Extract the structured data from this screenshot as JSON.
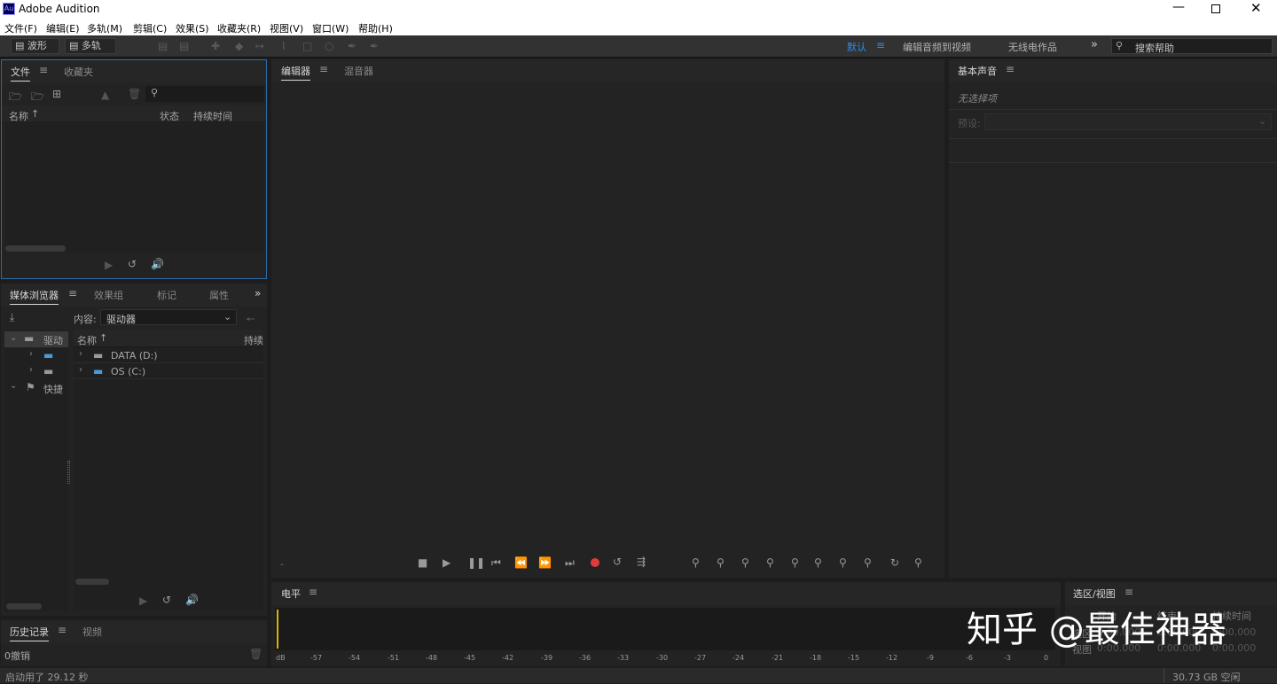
{
  "window": {
    "title": "Adobe Audition",
    "logo": "Au"
  },
  "menu": [
    "文件(F)",
    "编辑(E)",
    "多轨(M)",
    "剪辑(C)",
    "效果(S)",
    "收藏夹(R)",
    "视图(V)",
    "窗口(W)",
    "帮助(H)"
  ],
  "toolbar": {
    "waveform": "波形",
    "multitrack": "多轨",
    "workspaces": [
      "默认",
      "编辑音频到视频",
      "无线电作品"
    ],
    "search_placeholder": "搜索帮助"
  },
  "files_panel": {
    "tabs": [
      "文件",
      "收藏夹"
    ],
    "columns": [
      "名称",
      "状态",
      "持续时间"
    ]
  },
  "media_browser": {
    "tabs": [
      "媒体浏览器",
      "效果组",
      "标记",
      "属性"
    ],
    "content_label": "内容:",
    "content_value": "驱动器",
    "tree": [
      "驱动",
      "快捷"
    ],
    "list_header_name": "名称",
    "list_header_dur": "持续",
    "items": [
      "DATA (D:)",
      "OS (C:)"
    ]
  },
  "history": {
    "tabs": [
      "历史记录",
      "视频"
    ],
    "undo": "0撤销"
  },
  "editor": {
    "tabs": [
      "编辑器",
      "混音器"
    ],
    "dash": "-"
  },
  "levels": {
    "title": "电平",
    "scale": [
      "dB",
      "-57",
      "-54",
      "-51",
      "-48",
      "-45",
      "-42",
      "-39",
      "-36",
      "-33",
      "-30",
      "-27",
      "-24",
      "-21",
      "-18",
      "-15",
      "-12",
      "-9",
      "-6",
      "-3",
      "0"
    ]
  },
  "essential_sound": {
    "title": "基本声音",
    "no_selection": "无选择项",
    "preset_label": "预设:"
  },
  "selection_view": {
    "title": "选区/视图",
    "col1": "开始",
    "col2": "结束",
    "col3": "持续时间",
    "row1": "选区",
    "row2": "视图",
    "zero": "0:00.000"
  },
  "status": {
    "left": "启动用了 29.12 秒",
    "right": "30.73 GB 空闲"
  },
  "watermark": "知乎 @最佳神器",
  "colors": {
    "accent": "#2d8ceb",
    "record": "#e13c3c",
    "level_marker": "#d8b400"
  }
}
